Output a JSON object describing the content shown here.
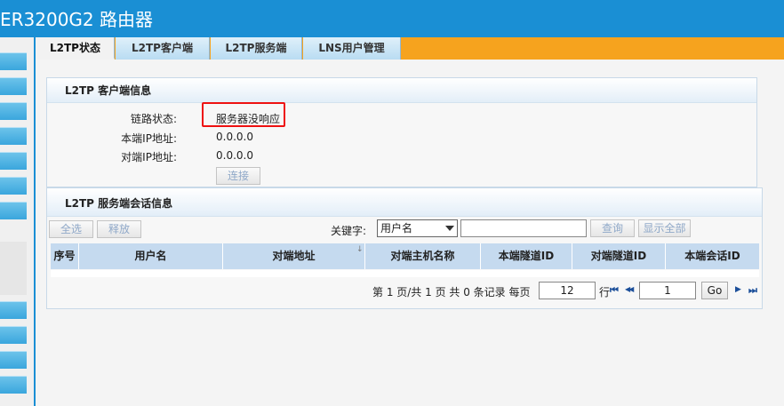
{
  "header": {
    "title": "ER3200G2 路由器"
  },
  "tabs": [
    {
      "label": "L2TP状态"
    },
    {
      "label": "L2TP客户端"
    },
    {
      "label": "L2TP服务端"
    },
    {
      "label": "LNS用户管理"
    }
  ],
  "client_panel": {
    "title": "L2TP 客户端信息",
    "link_status_label": "链路状态:",
    "link_status_value": "服务器没响应",
    "local_ip_label": "本端IP地址:",
    "local_ip_value": "0.0.0.0",
    "peer_ip_label": "对端IP地址:",
    "peer_ip_value": "0.0.0.0",
    "connect_button": "连接"
  },
  "server_panel": {
    "title": "L2TP 服务端会话信息",
    "select_all": "全选",
    "release": "释放",
    "keyword_label": "关键字:",
    "keyword_select": "用户名",
    "search_button": "查询",
    "show_all_button": "显示全部",
    "columns": [
      "序号",
      "用户名",
      "对端地址",
      "对端主机名称",
      "本端隧道ID",
      "对端隧道ID",
      "本端会话ID"
    ],
    "sort_indicator": "↓"
  },
  "pager": {
    "summary": "第 1 页/共 1 页 共 0 条记录 每页",
    "per_page": "12",
    "row_label": "行",
    "page_input": "1",
    "go_button": "Go",
    "first_icon": "⏮",
    "prev_icon": "◀◀",
    "next_icon": "▶",
    "last_icon": "⏭"
  }
}
